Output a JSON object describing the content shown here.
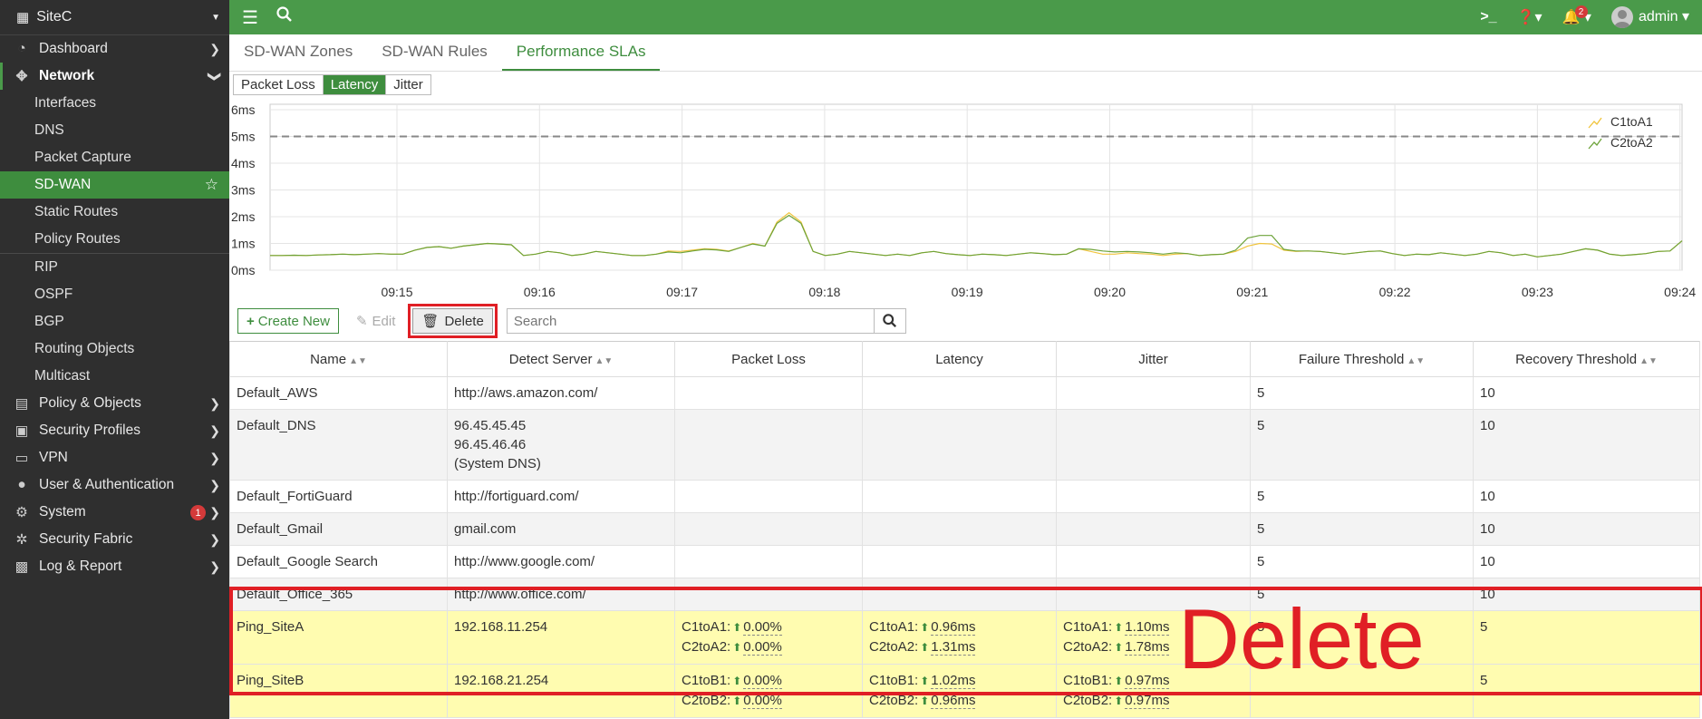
{
  "sidebar": {
    "device": "SiteC",
    "items": [
      {
        "label": "Dashboard",
        "icon": "dashboard-icon"
      },
      {
        "label": "Network",
        "icon": "network-icon"
      },
      {
        "label": "Interfaces"
      },
      {
        "label": "DNS"
      },
      {
        "label": "Packet Capture"
      },
      {
        "label": "SD-WAN"
      },
      {
        "label": "Static Routes"
      },
      {
        "label": "Policy Routes"
      },
      {
        "label": "RIP"
      },
      {
        "label": "OSPF"
      },
      {
        "label": "BGP"
      },
      {
        "label": "Routing Objects"
      },
      {
        "label": "Multicast"
      },
      {
        "label": "Policy & Objects",
        "icon": "policy-icon"
      },
      {
        "label": "Security Profiles",
        "icon": "lock-icon"
      },
      {
        "label": "VPN",
        "icon": "monitor-icon"
      },
      {
        "label": "User & Authentication",
        "icon": "user-icon"
      },
      {
        "label": "System",
        "icon": "gear-icon",
        "badge": "1"
      },
      {
        "label": "Security Fabric",
        "icon": "fabric-icon"
      },
      {
        "label": "Log & Report",
        "icon": "chart-icon"
      }
    ]
  },
  "topbar": {
    "notifications": "2",
    "user": "admin"
  },
  "tabs": [
    "SD-WAN Zones",
    "SD-WAN Rules",
    "Performance SLAs"
  ],
  "metric_tabs": [
    "Packet Loss",
    "Latency",
    "Jitter"
  ],
  "chart_data": {
    "type": "line",
    "y_ticks": [
      "6ms",
      "5ms",
      "4ms",
      "3ms",
      "2ms",
      "1ms",
      "0ms"
    ],
    "ylim": [
      0,
      6
    ],
    "x_ticks": [
      "09:15",
      "09:16",
      "09:17",
      "09:18",
      "09:19",
      "09:20",
      "09:21",
      "09:22",
      "09:23",
      "09:24"
    ],
    "threshold": 5,
    "series": [
      {
        "name": "C1toA1",
        "color": "#f0c43c",
        "values": [
          0.55,
          0.55,
          0.56,
          0.55,
          0.57,
          0.58,
          0.6,
          0.58,
          0.6,
          0.62,
          0.6,
          0.6,
          0.75,
          0.85,
          0.88,
          0.82,
          0.9,
          0.95,
          1.0,
          0.98,
          0.95,
          0.55,
          0.6,
          0.7,
          0.65,
          0.55,
          0.6,
          0.7,
          0.65,
          0.6,
          0.55,
          0.55,
          0.6,
          0.72,
          0.7,
          0.75,
          0.8,
          0.78,
          0.72,
          0.85,
          1.0,
          0.9,
          1.8,
          2.15,
          1.8,
          0.7,
          0.55,
          0.6,
          0.7,
          0.65,
          0.6,
          0.55,
          0.6,
          0.55,
          0.65,
          0.7,
          0.62,
          0.58,
          0.55,
          0.6,
          0.58,
          0.55,
          0.6,
          0.65,
          0.62,
          0.58,
          0.6,
          0.8,
          0.7,
          0.6,
          0.6,
          0.65,
          0.62,
          0.6,
          0.55,
          0.6,
          0.62,
          0.55,
          0.58,
          0.6,
          0.7,
          0.9,
          1.0,
          0.98,
          0.75,
          0.7,
          0.72,
          0.7,
          0.65,
          0.6,
          0.65,
          0.7,
          0.72,
          0.62,
          0.55,
          0.6,
          0.58,
          0.65,
          0.6,
          0.55,
          0.6,
          0.7,
          0.65,
          0.55,
          0.6,
          0.5,
          0.55,
          0.6,
          0.7,
          0.8,
          0.75,
          0.6,
          0.55,
          0.58,
          0.62,
          0.7,
          0.72,
          1.1
        ]
      },
      {
        "name": "C2toA2",
        "color": "#6da33a",
        "values": [
          0.55,
          0.55,
          0.56,
          0.55,
          0.57,
          0.58,
          0.6,
          0.58,
          0.6,
          0.62,
          0.6,
          0.6,
          0.75,
          0.85,
          0.88,
          0.82,
          0.9,
          0.95,
          1.0,
          0.98,
          0.95,
          0.55,
          0.6,
          0.7,
          0.65,
          0.55,
          0.6,
          0.7,
          0.65,
          0.6,
          0.55,
          0.55,
          0.6,
          0.68,
          0.65,
          0.72,
          0.78,
          0.76,
          0.7,
          0.85,
          0.98,
          0.9,
          1.75,
          2.05,
          1.75,
          0.7,
          0.55,
          0.6,
          0.7,
          0.65,
          0.6,
          0.55,
          0.6,
          0.55,
          0.65,
          0.7,
          0.62,
          0.58,
          0.55,
          0.6,
          0.58,
          0.55,
          0.6,
          0.65,
          0.62,
          0.58,
          0.6,
          0.8,
          0.78,
          0.72,
          0.68,
          0.7,
          0.68,
          0.65,
          0.6,
          0.65,
          0.62,
          0.55,
          0.58,
          0.6,
          0.75,
          1.2,
          1.3,
          1.3,
          0.78,
          0.72,
          0.72,
          0.7,
          0.65,
          0.6,
          0.65,
          0.7,
          0.72,
          0.62,
          0.55,
          0.6,
          0.58,
          0.65,
          0.6,
          0.55,
          0.6,
          0.7,
          0.65,
          0.55,
          0.6,
          0.5,
          0.55,
          0.6,
          0.7,
          0.8,
          0.75,
          0.6,
          0.55,
          0.58,
          0.62,
          0.7,
          0.72,
          1.1
        ]
      }
    ]
  },
  "toolbar": {
    "create": "Create New",
    "edit": "Edit",
    "delete": "Delete",
    "search_placeholder": "Search"
  },
  "table": {
    "headers": [
      "Name",
      "Detect Server",
      "Packet Loss",
      "Latency",
      "Jitter",
      "Failure Threshold",
      "Recovery Threshold"
    ],
    "rows": [
      {
        "name": "Default_AWS",
        "server": [
          "http://aws.amazon.com/"
        ],
        "fail": "5",
        "recover": "10"
      },
      {
        "name": "Default_DNS",
        "server": [
          "96.45.45.45",
          "96.45.46.46",
          "(System DNS)"
        ],
        "fail": "5",
        "recover": "10"
      },
      {
        "name": "Default_FortiGuard",
        "server": [
          "http://fortiguard.com/"
        ],
        "fail": "5",
        "recover": "10"
      },
      {
        "name": "Default_Gmail",
        "server": [
          "gmail.com"
        ],
        "fail": "5",
        "recover": "10"
      },
      {
        "name": "Default_Google Search",
        "server": [
          "http://www.google.com/"
        ],
        "fail": "5",
        "recover": "10"
      },
      {
        "name": "Default_Office_365",
        "server": [
          "http://www.office.com/"
        ],
        "fail": "5",
        "recover": "10"
      },
      {
        "name": "Ping_SiteA",
        "server": [
          "192.168.11.254"
        ],
        "fail": "5",
        "recover": "5",
        "loss": [
          {
            "m": "C1toA1:",
            "v": "0.00%"
          },
          {
            "m": "C2toA2:",
            "v": "0.00%"
          }
        ],
        "latency": [
          {
            "m": "C1toA1:",
            "v": "0.96ms"
          },
          {
            "m": "C2toA2:",
            "v": "1.31ms"
          }
        ],
        "jitter": [
          {
            "m": "C1toA1:",
            "v": "1.10ms"
          },
          {
            "m": "C2toA2:",
            "v": "1.78ms"
          }
        ]
      },
      {
        "name": "Ping_SiteB",
        "server": [
          "192.168.21.254"
        ],
        "fail": "",
        "recover": "5",
        "loss": [
          {
            "m": "C1toB1:",
            "v": "0.00%"
          },
          {
            "m": "C2toB2:",
            "v": "0.00%"
          }
        ],
        "latency": [
          {
            "m": "C1toB1:",
            "v": "1.02ms"
          },
          {
            "m": "C2toB2:",
            "v": "0.96ms"
          }
        ],
        "jitter": [
          {
            "m": "C1toB1:",
            "v": "0.97ms"
          },
          {
            "m": "C2toB2:",
            "v": "0.97ms"
          }
        ]
      }
    ]
  },
  "annotation": "Delete"
}
